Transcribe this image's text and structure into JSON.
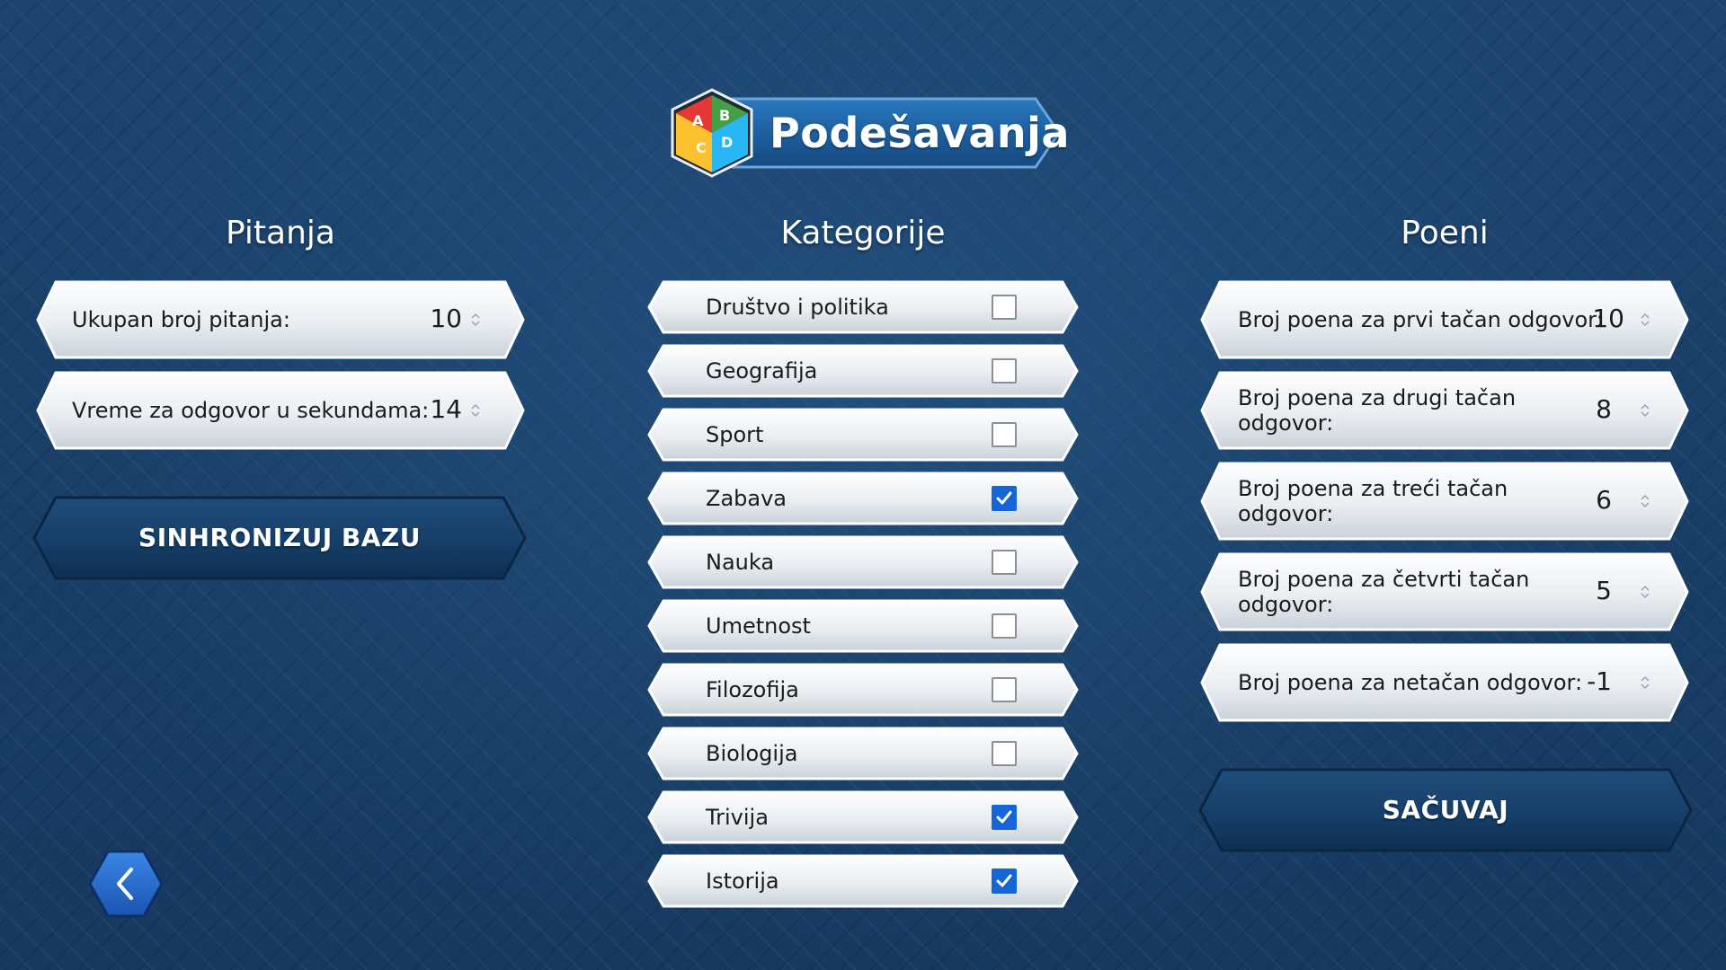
{
  "header": {
    "title": "Podešavanja",
    "logo_letters": [
      "A",
      "B",
      "C",
      "D"
    ]
  },
  "columns": {
    "questions_title": "Pitanja",
    "categories_title": "Kategorije",
    "points_title": "Poeni"
  },
  "questions": {
    "total_label": "Ukupan broj pitanja:",
    "total_value": "10",
    "time_label": "Vreme za odgovor u sekundama:",
    "time_value": "14",
    "sync_button": "SINHRONIZUJ BAZU"
  },
  "categories": [
    {
      "label": "Društvo i politika",
      "checked": false
    },
    {
      "label": "Geografija",
      "checked": false
    },
    {
      "label": "Sport",
      "checked": false
    },
    {
      "label": "Zabava",
      "checked": true
    },
    {
      "label": "Nauka",
      "checked": false
    },
    {
      "label": "Umetnost",
      "checked": false
    },
    {
      "label": "Filozofija",
      "checked": false
    },
    {
      "label": "Biologija",
      "checked": false
    },
    {
      "label": "Trivija",
      "checked": true
    },
    {
      "label": "Istorija",
      "checked": true
    }
  ],
  "points": {
    "first_label": "Broj poena za prvi tačan odgovor:",
    "first_value": "10",
    "second_label_line1": "Broj poena za drugi tačan",
    "second_label_line2": "odgovor:",
    "second_value": "8",
    "third_label_line1": "Broj poena za treći tačan",
    "third_label_line2": "odgovor:",
    "third_value": "6",
    "fourth_label_line1": "Broj poena za četvrti tačan",
    "fourth_label_line2": "odgovor:",
    "fourth_value": "5",
    "wrong_label": "Broj poena za netačan odgovor:",
    "wrong_value": "-1",
    "save_button": "SAČUVAJ"
  },
  "icons": {
    "back": "chevron-left-icon",
    "spinner": "spinner-arrows-icon",
    "check": "checkmark-icon"
  },
  "colors": {
    "background": "#1a3f68",
    "panel_silver": "#e9eef3",
    "button_dark": "#153a60",
    "checkbox_checked": "#1565d8",
    "back_button": "#1f63c8"
  }
}
